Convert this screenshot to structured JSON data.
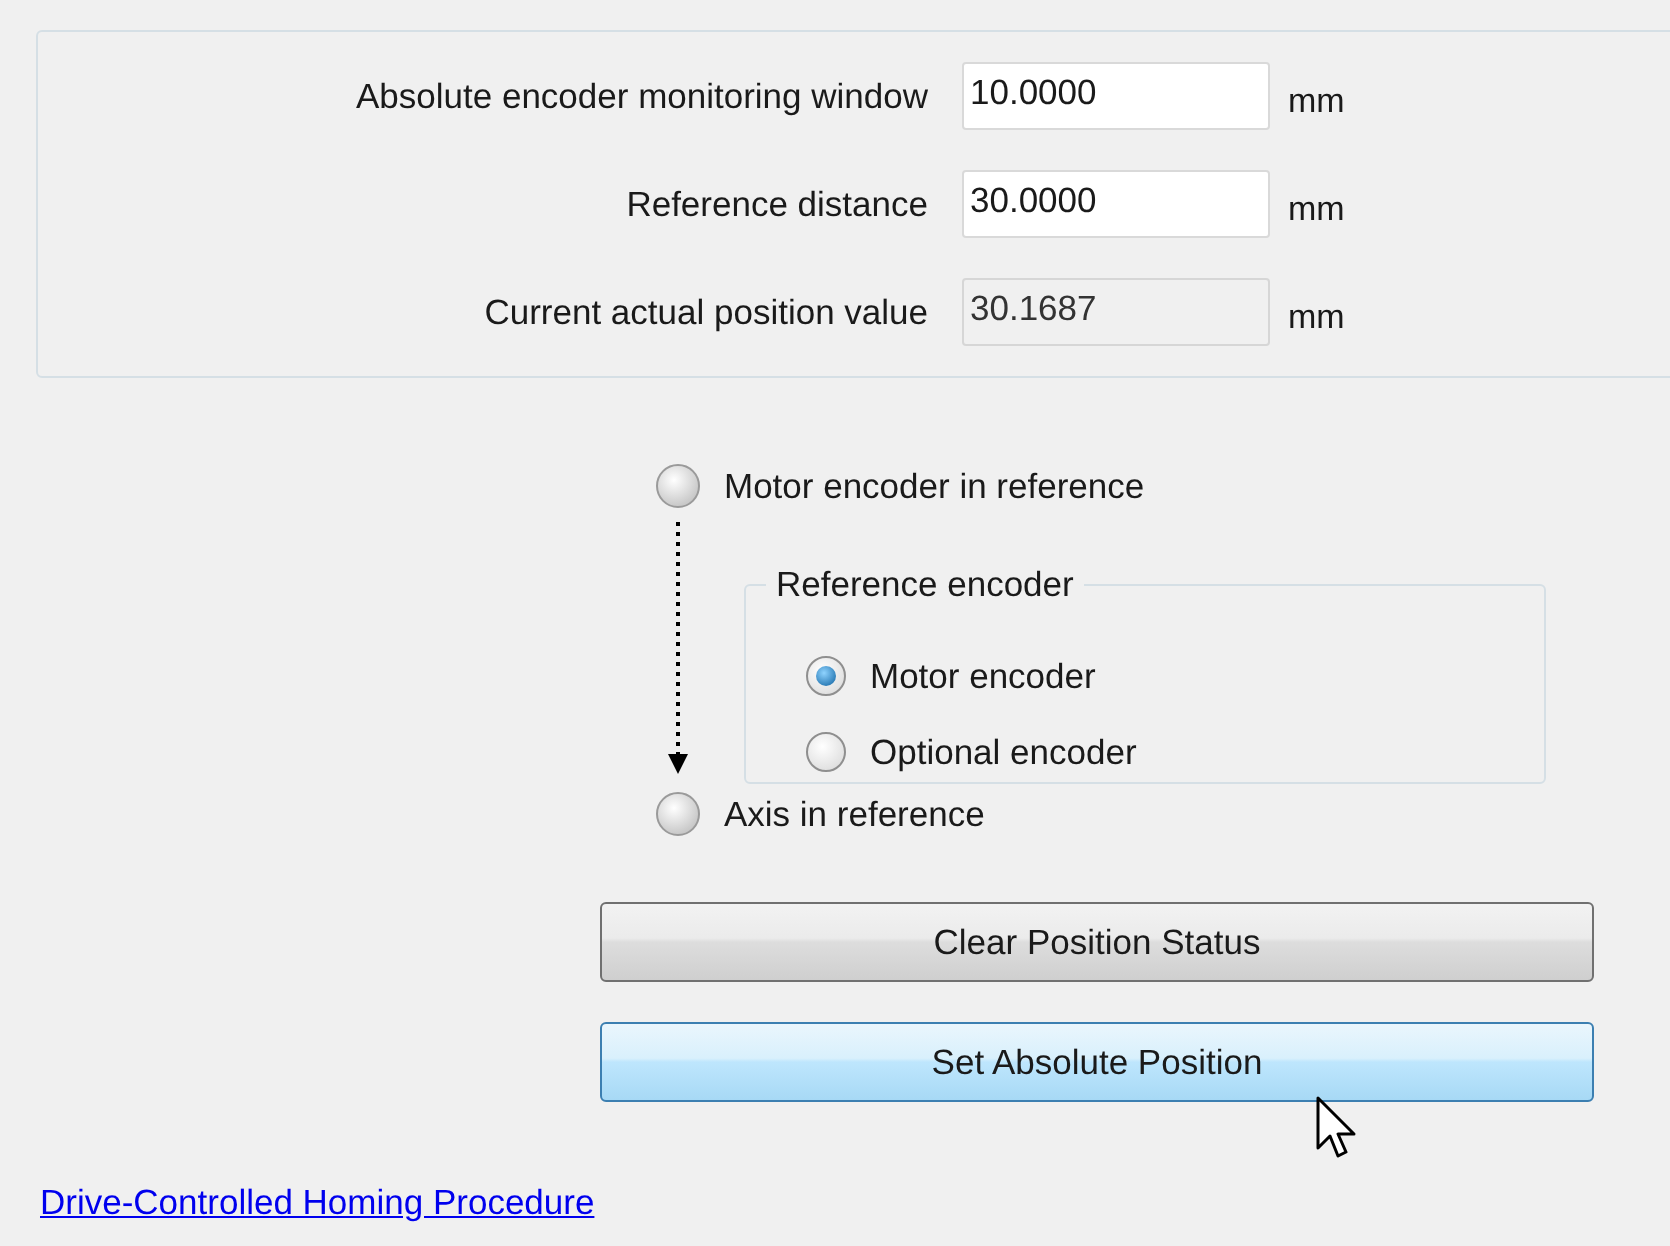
{
  "parameters": [
    {
      "label": "Absolute encoder monitoring window",
      "value": "10.0000",
      "unit": "mm",
      "readonly": false
    },
    {
      "label": "Reference distance",
      "value": "30.0000",
      "unit": "mm",
      "readonly": false
    },
    {
      "label": "Current actual position value",
      "value": "30.1687",
      "unit": "mm",
      "readonly": true
    }
  ],
  "status": {
    "motor_encoder_in_reference": {
      "label": "Motor encoder in reference",
      "on": false
    },
    "axis_in_reference": {
      "label": "Axis in reference",
      "on": false
    }
  },
  "reference_encoder": {
    "title": "Reference encoder",
    "options": [
      {
        "label": "Motor encoder",
        "selected": true
      },
      {
        "label": "Optional encoder",
        "selected": false
      }
    ]
  },
  "buttons": [
    {
      "label": "Clear Position Status",
      "hovered": false
    },
    {
      "label": "Set Absolute Position",
      "hovered": true
    }
  ],
  "link": "Drive-Controlled Homing Procedure"
}
